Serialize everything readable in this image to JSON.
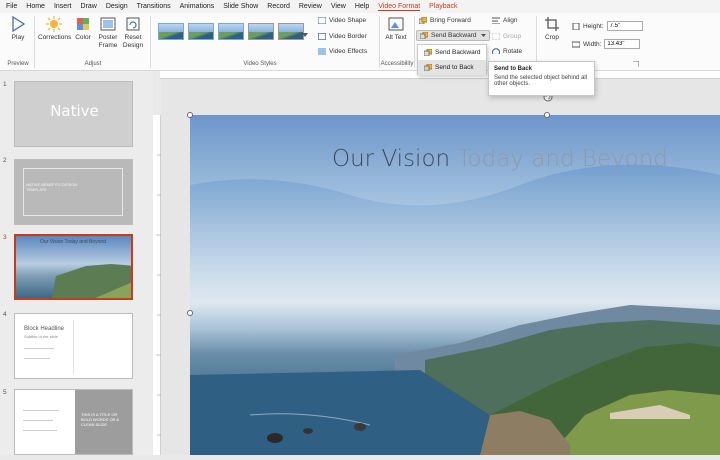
{
  "menu": {
    "items": [
      "File",
      "Home",
      "Insert",
      "Draw",
      "Design",
      "Transitions",
      "Animations",
      "Slide Show",
      "Record",
      "Review",
      "View",
      "Help"
    ],
    "active": "Video Format",
    "playback": "Playback"
  },
  "ribbon": {
    "play": "Play",
    "preview_group": "Preview",
    "corrections": "Corrections",
    "color": "Color",
    "poster_frame": "Poster Frame",
    "reset_design": "Reset Design",
    "adjust_group": "Adjust",
    "video_styles_group": "Video Styles",
    "video_shape": "Video Shape",
    "video_border": "Video Border",
    "video_effects": "Video Effects",
    "alt_text": "Alt Text",
    "accessibility_group": "Accessibility",
    "bring_forward": "Bring Forward",
    "send_backward": "Send Backward",
    "align": "Align",
    "group": "Group",
    "rotate": "Rotate",
    "crop": "Crop",
    "height_label": "Height:",
    "height_value": "7.5\"",
    "width_label": "Width:",
    "width_value": "13.43\""
  },
  "dropdown": {
    "send_backward": "Send Backward",
    "send_to_back": "Send to Back"
  },
  "tooltip": {
    "title": "Send to Back",
    "body": "Send the selected object behind all other objects."
  },
  "slides": [
    {
      "num": "1",
      "title": "Native"
    },
    {
      "num": "2",
      "text": "NATIVE BENEFITS DESIGN TEMPLATE"
    },
    {
      "num": "3",
      "title": "Our Vision Today and Beyond"
    },
    {
      "num": "4",
      "title": "Block Headline",
      "subtitle": "Subtitle of the slide"
    },
    {
      "num": "5",
      "text": "THIS IS A TITLE OR BOLD WORDS OR A CLEAN SLIDE"
    }
  ],
  "main_slide": {
    "title_dark": "Our Vision",
    "title_light": "Today and Beyond"
  },
  "colors": {
    "accent": "#c43e1c"
  }
}
